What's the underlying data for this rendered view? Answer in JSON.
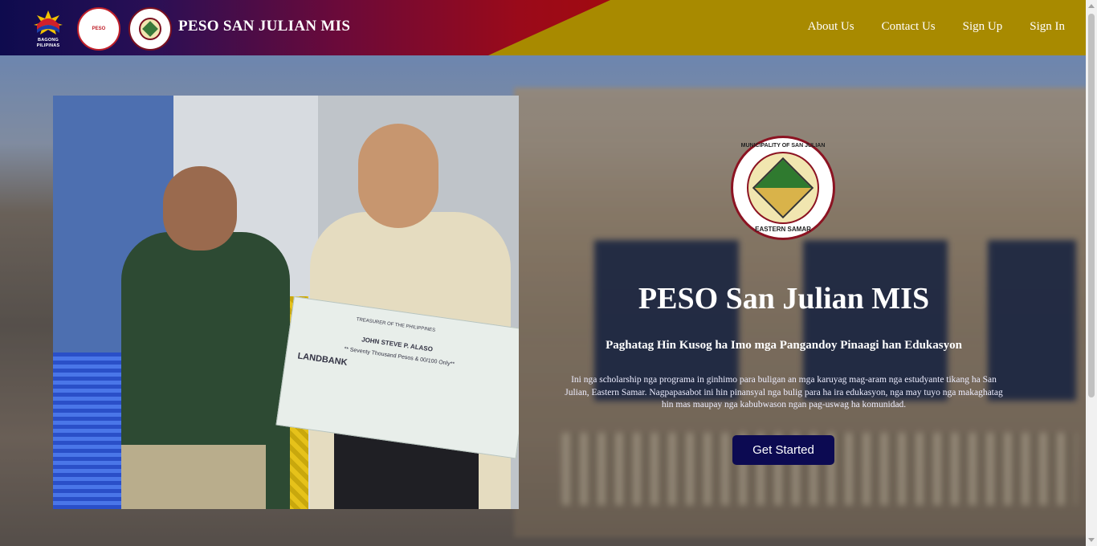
{
  "header": {
    "logos": [
      {
        "name": "bagong-pilipinas-logo",
        "caption": "BAGONG PILIPINAS"
      },
      {
        "name": "peso-logo",
        "caption": "PESO"
      },
      {
        "name": "municipality-seal-logo",
        "caption": "MUNICIPALITY OF SAN JULIAN"
      }
    ],
    "brand": "PESO SAN JULIAN MIS",
    "nav": [
      "About Us",
      "Contact Us",
      "Sign Up",
      "Sign In"
    ]
  },
  "hero": {
    "seal": {
      "top_text": "MUNICIPALITY OF SAN JULIAN",
      "bottom_text": "EASTERN SAMAR"
    },
    "title": "PESO San Julian MIS",
    "subtitle": "Paghatag Hin Kusog ha Imo mga Pangandoy Pinaagi han Edukasyon",
    "description": "Ini nga scholarship nga programa in ginhimo para buligan an mga karuyag mag-aram nga estudyante tikang ha San Julian, Eastern Samar. Nagpapasabot ini hin pinansyal nga bulig para ha ira edukasyon, nga may tuyo nga makaghatag hin mas maupay nga kabubwason ngan pag-uswag ha komunidad.",
    "cta_label": "Get Started",
    "photo": {
      "check_payee": "JOHN STEVE P. ALASO",
      "check_amount_words": "** Seventy Thousand Pesos & 00/100 Only**",
      "check_bank": "LANDBANK",
      "check_payor": "TREASURER OF THE PHILIPPINES"
    }
  },
  "colors": {
    "header_gold": "#a88a00",
    "header_navy": "#0e0b4e",
    "header_red": "#a10a10",
    "cta_bg": "#0c0a52"
  }
}
